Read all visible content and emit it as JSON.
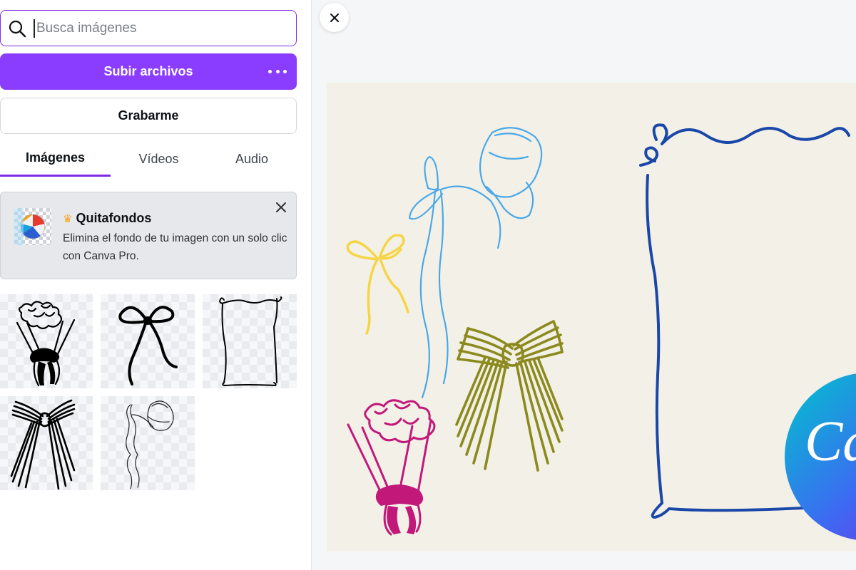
{
  "search": {
    "placeholder": "Busca imágenes",
    "value": ""
  },
  "upload_button": {
    "label": "Subir archivos"
  },
  "record_button": {
    "label": "Grabarme"
  },
  "tabs": [
    {
      "label": "Imágenes",
      "active": true
    },
    {
      "label": "Vídeos",
      "active": false
    },
    {
      "label": "Audio",
      "active": false
    }
  ],
  "promo": {
    "title": "Quitafondos",
    "description": "Elimina el fondo de tu imagen con un solo clic con Canva Pro.",
    "badge_icon": "crown-icon"
  },
  "thumbnails": [
    {
      "name": "bouquet-sketch"
    },
    {
      "name": "ribbon-bow-sketch"
    },
    {
      "name": "hand-drawn-frame"
    },
    {
      "name": "striped-bow"
    },
    {
      "name": "bonnet-ribbon-sketch"
    }
  ],
  "canvas": {
    "background": "#f3f1e7",
    "elements": [
      {
        "name": "yellow-bow",
        "color": "#f5d547"
      },
      {
        "name": "blue-bonnet-ribbon",
        "color": "#4aa8e8"
      },
      {
        "name": "olive-striped-bow",
        "color": "#8c8a1e"
      },
      {
        "name": "magenta-bouquet",
        "color": "#c2187a"
      },
      {
        "name": "navy-frame",
        "color": "#1a48a8"
      },
      {
        "name": "canva-logo-badge",
        "color": "#00c4cc"
      }
    ],
    "logo_text": "Ca"
  },
  "colors": {
    "accent": "#8b3dff",
    "search_border": "#7d2ae8"
  }
}
